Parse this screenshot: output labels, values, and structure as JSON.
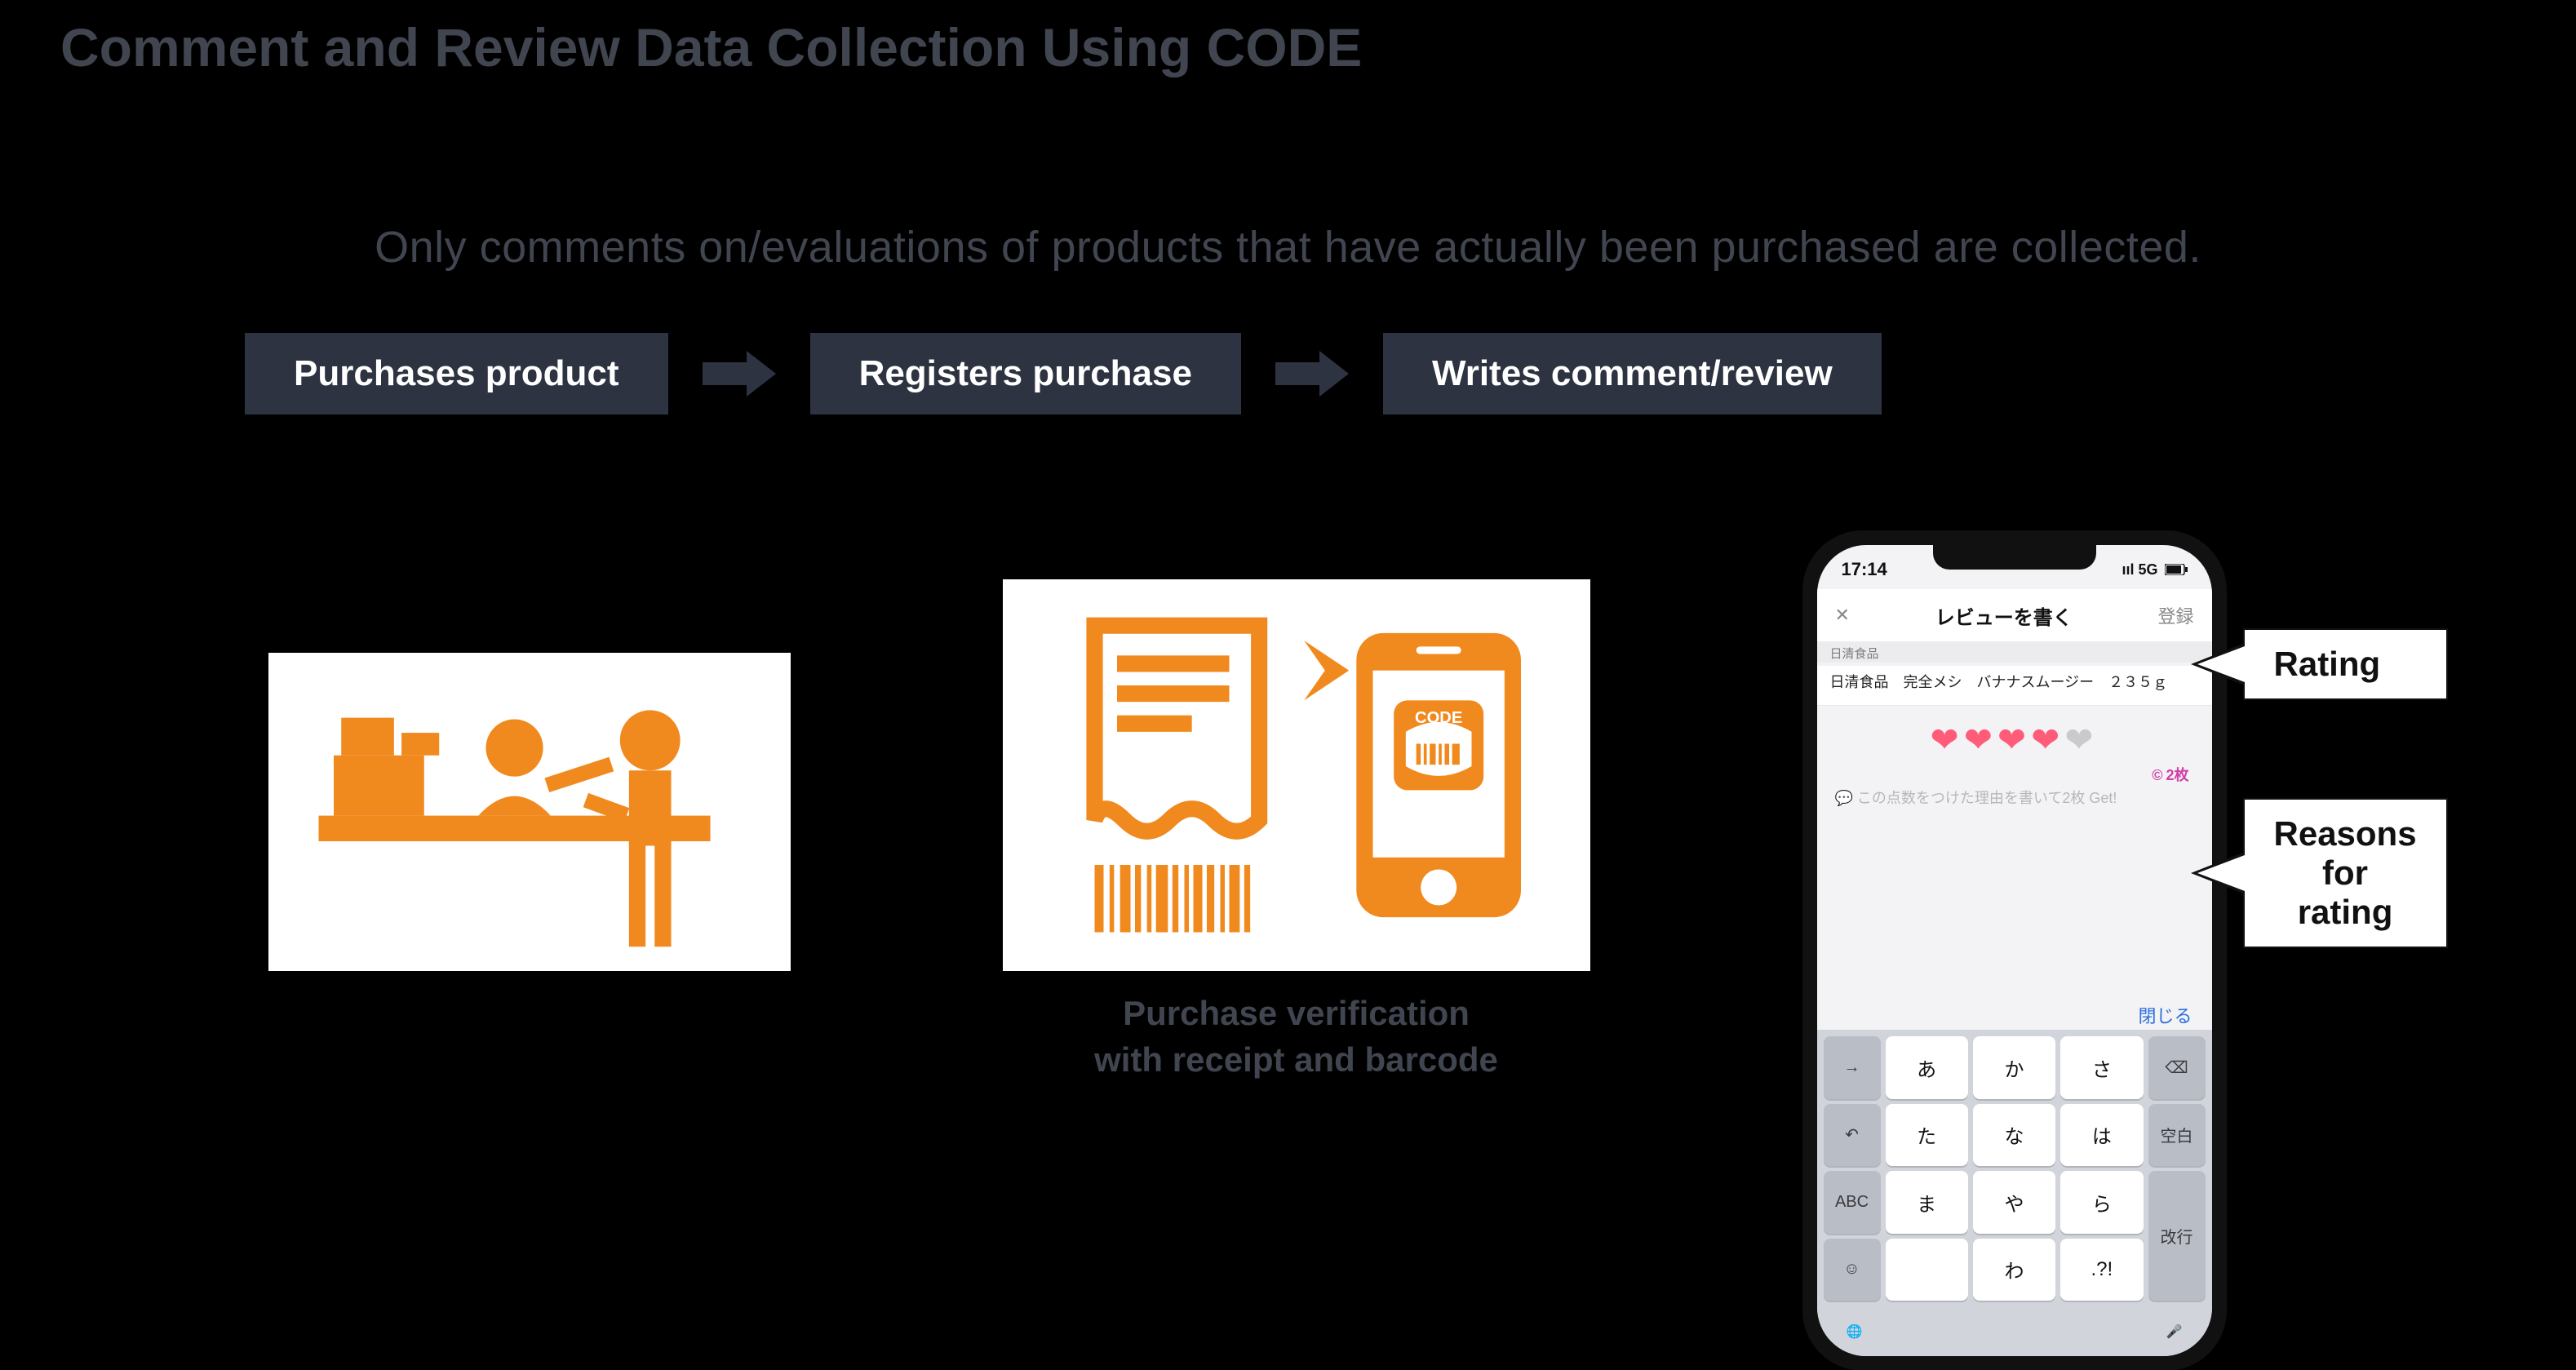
{
  "title": "Comment and Review Data Collection Using CODE",
  "subtitle": "Only comments on/evaluations of products that have actually been purchased are collected.",
  "steps": [
    "Purchases product",
    "Registers purchase",
    "Writes comment/review"
  ],
  "register_caption": "Purchase verification\nwith receipt and barcode",
  "callouts": {
    "rating": "Rating",
    "reasons": "Reasons\nfor rating"
  },
  "phone": {
    "time": "17:14",
    "signal": "ııl 5G",
    "close": "✕",
    "header_title": "レビューを書く",
    "header_action": "登録",
    "brand_band": "日清食品",
    "product_line": "日清食品　完全メシ　バナナスムージー　２３５ｇ",
    "badge": "2枚",
    "placeholder": "この点数をつけた理由を書いて2枚 Get!",
    "close_keyboard": "閉じる",
    "kbd_rows": [
      [
        "→",
        "あ",
        "か",
        "さ",
        "⌫"
      ],
      [
        "↶",
        "た",
        "な",
        "は",
        "空白"
      ],
      [
        "ABC",
        "ま",
        "や",
        "ら",
        "改行"
      ],
      [
        "☺",
        "　",
        "わ",
        ".?!",
        ""
      ]
    ],
    "globe": "🌐",
    "mic": "🎤"
  },
  "colors": {
    "orange": "#f08a1e",
    "steps_bg": "#2d3340",
    "muted": "#404550"
  }
}
